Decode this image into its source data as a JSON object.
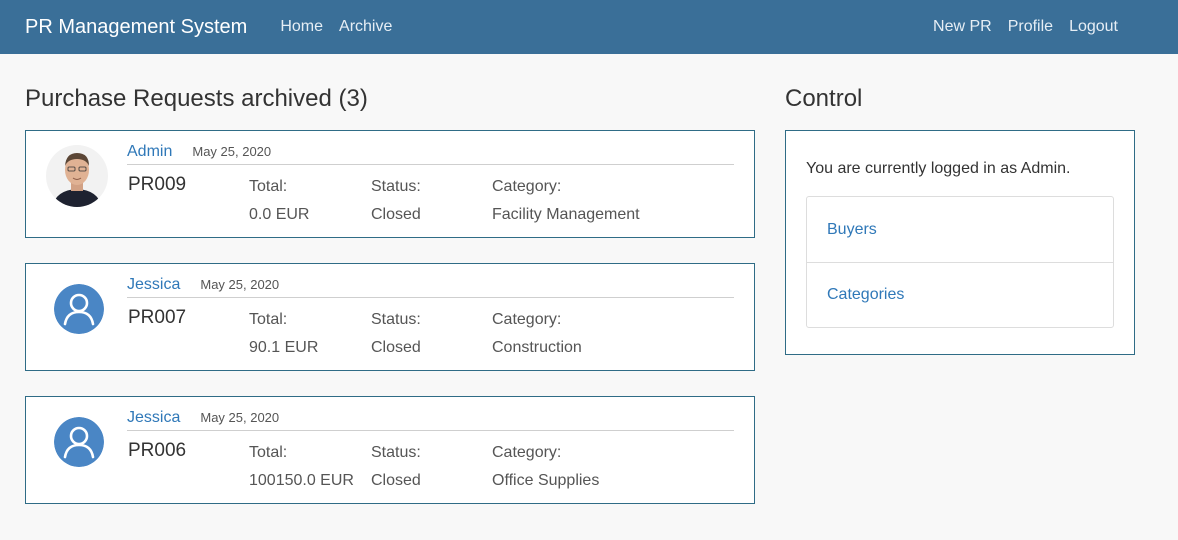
{
  "nav": {
    "brand": "PR Management System",
    "home": "Home",
    "archive": "Archive",
    "new_pr": "New PR",
    "profile": "Profile",
    "logout": "Logout"
  },
  "archive": {
    "heading": "Purchase Requests archived (3)",
    "requests": [
      {
        "user": "Admin",
        "date": "May 25, 2020",
        "id": "PR009",
        "total_label": "Total:",
        "total": "0.0 EUR",
        "status_label": "Status:",
        "status": "Closed",
        "category_label": "Category:",
        "category": "Facility Management",
        "avatar": "admin-photo"
      },
      {
        "user": "Jessica",
        "date": "May 25, 2020",
        "id": "PR007",
        "total_label": "Total:",
        "total": "90.1 EUR",
        "status_label": "Status:",
        "status": "Closed",
        "category_label": "Category:",
        "category": "Construction",
        "avatar": "user-icon"
      },
      {
        "user": "Jessica",
        "date": "May 25, 2020",
        "id": "PR006",
        "total_label": "Total:",
        "total": "100150.0 EUR",
        "status_label": "Status:",
        "status": "Closed",
        "category_label": "Category:",
        "category": "Office Supplies",
        "avatar": "user-icon"
      }
    ]
  },
  "control": {
    "heading": "Control",
    "login_text": "You are currently logged in as Admin.",
    "links": [
      "Buyers",
      "Categories"
    ]
  },
  "colors": {
    "navbar": "#3a6f98",
    "accent_link": "#2f78b8",
    "card_border": "#2f6c86",
    "avatar_blue": "#4a86c5"
  }
}
